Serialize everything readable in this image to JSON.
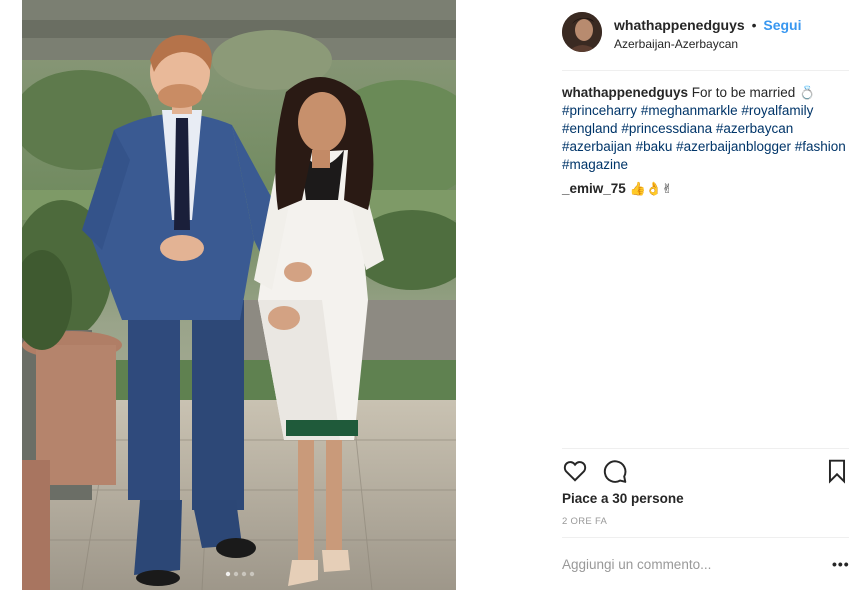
{
  "post": {
    "username": "whathappenedguys",
    "dot": "•",
    "follow_label": "Segui",
    "location": "Azerbaijan-Azerbaycan",
    "caption_text": "For to be married",
    "caption_emoji": "💍",
    "hashtags": [
      "#princeharry",
      "#meghanmarkle",
      "#royalfamily",
      "#england",
      "#princessdiana",
      "#azerbaycan",
      "#azerbaijan",
      "#baku",
      "#azerbaijanblogger",
      "#fashion",
      "#magazine"
    ],
    "comment": {
      "username": "_emiw_75",
      "text": "👍👌✌"
    },
    "likes_text": "Piace a 30 persone",
    "time_text": "2 ORE FA",
    "comment_placeholder": "Aggiungi un commento...",
    "more_label": "•••"
  },
  "icons": {
    "like": "heart-icon",
    "comment": "comment-icon",
    "save": "bookmark-icon"
  }
}
